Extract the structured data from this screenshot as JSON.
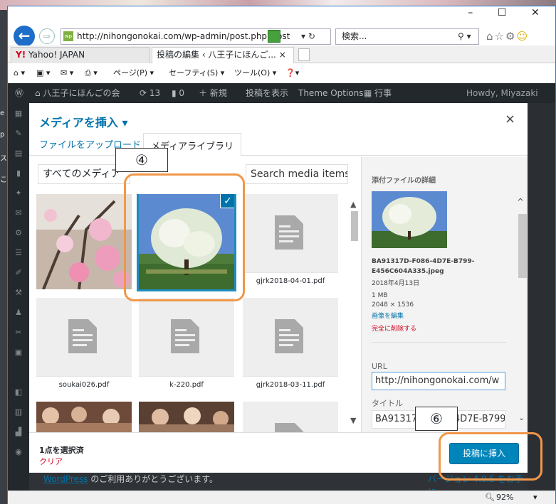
{
  "browser": {
    "address": "http://nihongonokai.com/wp-admin/post.php?post",
    "search_placeholder": "検索...",
    "tabs": [
      {
        "label": "Yahoo! JAPAN"
      },
      {
        "label": "投稿の編集 ‹ 八王子にほんご..."
      }
    ],
    "commands": [
      "ページ(P) ▾",
      "セーフティ(S) ▾",
      "ツール(O) ▾"
    ],
    "zoom": "92%"
  },
  "wp": {
    "admin_bar": [
      "八王子にほんごの会",
      "13",
      "0",
      "＋ 新規",
      "投稿を表示",
      "Theme Options",
      "行事"
    ],
    "greeting": "Howdy, Miyazaki",
    "footer_link": "WordPress",
    "footer_text": " のご利用ありがとうございます。",
    "footer_right": "バージョン 4.9.5 をお手に..."
  },
  "modal": {
    "title": "メディアを挿入 ▾",
    "close": "×",
    "tab_upload": "ファイルをアップロード",
    "tab_library": "メディアライブラリ",
    "filter_value": "すべてのメディア",
    "search_placeholder": "Search media items...",
    "tiles": [
      {
        "kind": "image",
        "name": ""
      },
      {
        "kind": "image",
        "name": "",
        "selected": true
      },
      {
        "kind": "doc",
        "name": "gjrk2018-04-01.pdf"
      },
      {
        "kind": "doc",
        "name": "soukai026.pdf"
      },
      {
        "kind": "doc",
        "name": "k-220.pdf"
      },
      {
        "kind": "doc",
        "name": "gjrk2018-03-11.pdf"
      },
      {
        "kind": "image",
        "name": ""
      },
      {
        "kind": "image",
        "name": ""
      },
      {
        "kind": "doc",
        "name": ""
      }
    ],
    "details": {
      "heading": "添付ファイルの詳細",
      "filename_line1": "BA91317D-F086-4D7E-B799-",
      "filename_line2": "E456C604A335.jpeg",
      "date": "2018年4月13日",
      "size": "1 MB",
      "dimensions": "2048 × 1536",
      "edit_link": "画像を編集",
      "delete_link": "完全に削除する",
      "url_label": "URL",
      "url_value": "http://nihongonokai.com/w",
      "title_label": "タイトル",
      "title_value": "BA91317D-F086-4D7E-B799"
    },
    "toolbar": {
      "selected_count": "1点を選択済",
      "clear": "クリア",
      "insert_button": "投稿に挿入"
    }
  },
  "annotations": {
    "step4": "④",
    "step6": "⑥",
    "color": "#f0984a"
  },
  "colors": {
    "wp_blue": "#0073aa",
    "button_blue": "#0085ba",
    "delete_red": "#d0021b"
  }
}
